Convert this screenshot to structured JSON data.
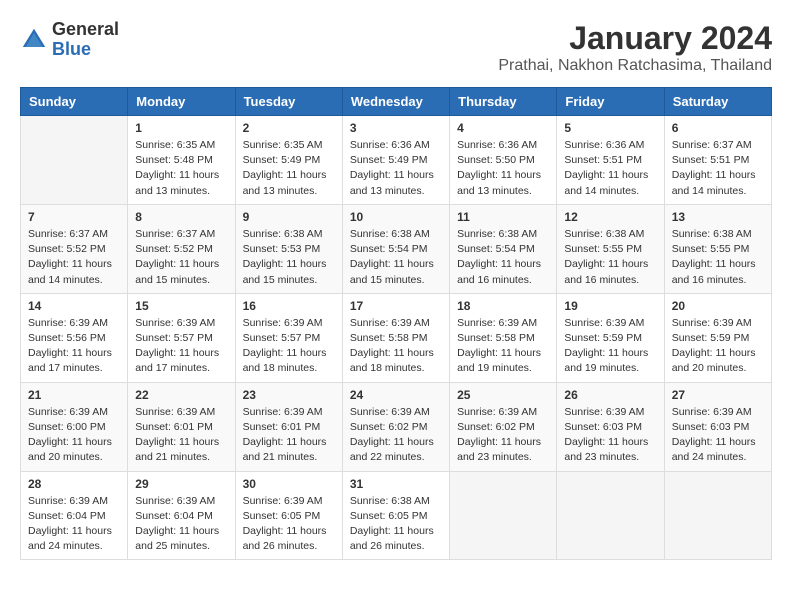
{
  "header": {
    "logo_general": "General",
    "logo_blue": "Blue",
    "month_title": "January 2024",
    "location": "Prathai, Nakhon Ratchasima, Thailand"
  },
  "calendar": {
    "days_of_week": [
      "Sunday",
      "Monday",
      "Tuesday",
      "Wednesday",
      "Thursday",
      "Friday",
      "Saturday"
    ],
    "weeks": [
      [
        {
          "day": "",
          "info": ""
        },
        {
          "day": "1",
          "info": "Sunrise: 6:35 AM\nSunset: 5:48 PM\nDaylight: 11 hours\nand 13 minutes."
        },
        {
          "day": "2",
          "info": "Sunrise: 6:35 AM\nSunset: 5:49 PM\nDaylight: 11 hours\nand 13 minutes."
        },
        {
          "day": "3",
          "info": "Sunrise: 6:36 AM\nSunset: 5:49 PM\nDaylight: 11 hours\nand 13 minutes."
        },
        {
          "day": "4",
          "info": "Sunrise: 6:36 AM\nSunset: 5:50 PM\nDaylight: 11 hours\nand 13 minutes."
        },
        {
          "day": "5",
          "info": "Sunrise: 6:36 AM\nSunset: 5:51 PM\nDaylight: 11 hours\nand 14 minutes."
        },
        {
          "day": "6",
          "info": "Sunrise: 6:37 AM\nSunset: 5:51 PM\nDaylight: 11 hours\nand 14 minutes."
        }
      ],
      [
        {
          "day": "7",
          "info": "Sunrise: 6:37 AM\nSunset: 5:52 PM\nDaylight: 11 hours\nand 14 minutes."
        },
        {
          "day": "8",
          "info": "Sunrise: 6:37 AM\nSunset: 5:52 PM\nDaylight: 11 hours\nand 15 minutes."
        },
        {
          "day": "9",
          "info": "Sunrise: 6:38 AM\nSunset: 5:53 PM\nDaylight: 11 hours\nand 15 minutes."
        },
        {
          "day": "10",
          "info": "Sunrise: 6:38 AM\nSunset: 5:54 PM\nDaylight: 11 hours\nand 15 minutes."
        },
        {
          "day": "11",
          "info": "Sunrise: 6:38 AM\nSunset: 5:54 PM\nDaylight: 11 hours\nand 16 minutes."
        },
        {
          "day": "12",
          "info": "Sunrise: 6:38 AM\nSunset: 5:55 PM\nDaylight: 11 hours\nand 16 minutes."
        },
        {
          "day": "13",
          "info": "Sunrise: 6:38 AM\nSunset: 5:55 PM\nDaylight: 11 hours\nand 16 minutes."
        }
      ],
      [
        {
          "day": "14",
          "info": "Sunrise: 6:39 AM\nSunset: 5:56 PM\nDaylight: 11 hours\nand 17 minutes."
        },
        {
          "day": "15",
          "info": "Sunrise: 6:39 AM\nSunset: 5:57 PM\nDaylight: 11 hours\nand 17 minutes."
        },
        {
          "day": "16",
          "info": "Sunrise: 6:39 AM\nSunset: 5:57 PM\nDaylight: 11 hours\nand 18 minutes."
        },
        {
          "day": "17",
          "info": "Sunrise: 6:39 AM\nSunset: 5:58 PM\nDaylight: 11 hours\nand 18 minutes."
        },
        {
          "day": "18",
          "info": "Sunrise: 6:39 AM\nSunset: 5:58 PM\nDaylight: 11 hours\nand 19 minutes."
        },
        {
          "day": "19",
          "info": "Sunrise: 6:39 AM\nSunset: 5:59 PM\nDaylight: 11 hours\nand 19 minutes."
        },
        {
          "day": "20",
          "info": "Sunrise: 6:39 AM\nSunset: 5:59 PM\nDaylight: 11 hours\nand 20 minutes."
        }
      ],
      [
        {
          "day": "21",
          "info": "Sunrise: 6:39 AM\nSunset: 6:00 PM\nDaylight: 11 hours\nand 20 minutes."
        },
        {
          "day": "22",
          "info": "Sunrise: 6:39 AM\nSunset: 6:01 PM\nDaylight: 11 hours\nand 21 minutes."
        },
        {
          "day": "23",
          "info": "Sunrise: 6:39 AM\nSunset: 6:01 PM\nDaylight: 11 hours\nand 21 minutes."
        },
        {
          "day": "24",
          "info": "Sunrise: 6:39 AM\nSunset: 6:02 PM\nDaylight: 11 hours\nand 22 minutes."
        },
        {
          "day": "25",
          "info": "Sunrise: 6:39 AM\nSunset: 6:02 PM\nDaylight: 11 hours\nand 23 minutes."
        },
        {
          "day": "26",
          "info": "Sunrise: 6:39 AM\nSunset: 6:03 PM\nDaylight: 11 hours\nand 23 minutes."
        },
        {
          "day": "27",
          "info": "Sunrise: 6:39 AM\nSunset: 6:03 PM\nDaylight: 11 hours\nand 24 minutes."
        }
      ],
      [
        {
          "day": "28",
          "info": "Sunrise: 6:39 AM\nSunset: 6:04 PM\nDaylight: 11 hours\nand 24 minutes."
        },
        {
          "day": "29",
          "info": "Sunrise: 6:39 AM\nSunset: 6:04 PM\nDaylight: 11 hours\nand 25 minutes."
        },
        {
          "day": "30",
          "info": "Sunrise: 6:39 AM\nSunset: 6:05 PM\nDaylight: 11 hours\nand 26 minutes."
        },
        {
          "day": "31",
          "info": "Sunrise: 6:38 AM\nSunset: 6:05 PM\nDaylight: 11 hours\nand 26 minutes."
        },
        {
          "day": "",
          "info": ""
        },
        {
          "day": "",
          "info": ""
        },
        {
          "day": "",
          "info": ""
        }
      ]
    ]
  }
}
